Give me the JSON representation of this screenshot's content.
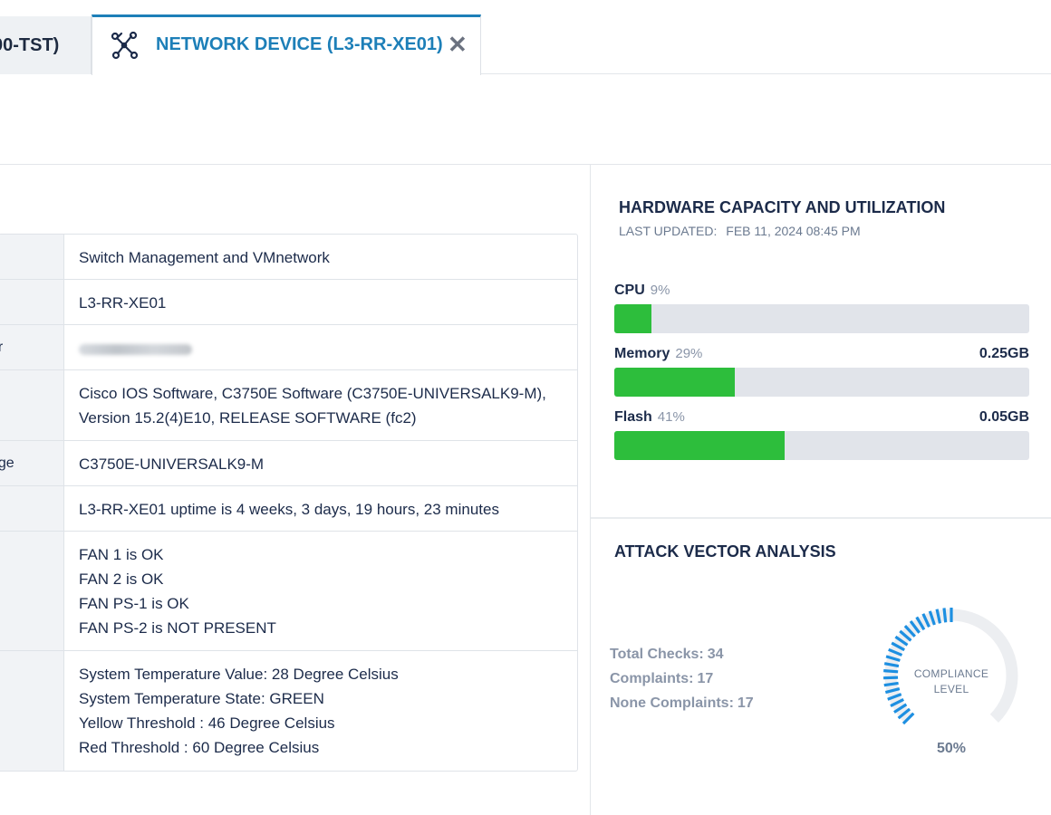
{
  "tabs": {
    "previous_label": "00-TST)",
    "active_label": "NETWORK DEVICE (L3-RR-XE01)",
    "close_symbol": "✕"
  },
  "device_info": {
    "rows": [
      {
        "key": "",
        "lines": [
          "Switch Management and VMnetwork"
        ]
      },
      {
        "key": "",
        "lines": [
          "L3-RR-XE01"
        ]
      },
      {
        "key": "er",
        "lines": [],
        "blurred": true
      },
      {
        "key": "",
        "lines": [
          "Cisco IOS Software, C3750E Software (C3750E-UNIVERSALK9-M),",
          "Version 15.2(4)E10, RELEASE SOFTWARE (fc2)"
        ]
      },
      {
        "key": "age",
        "lines": [
          "C3750E-UNIVERSALK9-M"
        ]
      },
      {
        "key": "",
        "lines": [
          "L3-RR-XE01 uptime is 4 weeks, 3 days, 19 hours, 23 minutes"
        ]
      },
      {
        "key": "",
        "lines": [
          "FAN 1 is OK",
          "FAN 2 is OK",
          "FAN PS-1 is OK",
          "FAN PS-2 is NOT PRESENT"
        ]
      },
      {
        "key": "",
        "lines": [
          "System Temperature Value: 28 Degree Celsius",
          "System Temperature State: GREEN",
          "Yellow Threshold : 46 Degree Celsius",
          "Red Threshold : 60 Degree Celsius"
        ]
      }
    ]
  },
  "hardware": {
    "title": "HARDWARE CAPACITY AND UTILIZATION",
    "last_updated_label": "LAST UPDATED:",
    "last_updated_value": "FEB 11, 2024 08:45 PM",
    "metrics": [
      {
        "name": "CPU",
        "percent_label": "9%",
        "fraction": 0.09,
        "size": ""
      },
      {
        "name": "Memory",
        "percent_label": "29%",
        "fraction": 0.29,
        "size": "0.25GB"
      },
      {
        "name": "Flash",
        "percent_label": "41%",
        "fraction": 0.41,
        "size": "0.05GB"
      }
    ],
    "bar_fill_color": "#2dbe3c",
    "bar_track_color": "#e1e4ea"
  },
  "attack_vector": {
    "title": "ATTACK VECTOR ANALYSIS",
    "total_checks_label": "Total Checks:",
    "total_checks_value": "34",
    "complaints_label": "Complaints:",
    "complaints_value": "17",
    "none_complaints_label": "None Complaints:",
    "none_complaints_value": "17",
    "gauge_label_line1": "COMPLIANCE",
    "gauge_label_line2": "LEVEL",
    "gauge_percent_label": "50%",
    "gauge_fraction": 0.5,
    "gauge_color": "#1d8fe1",
    "gauge_track_color": "#eceef1"
  },
  "accent_color": "#1d7fb8"
}
